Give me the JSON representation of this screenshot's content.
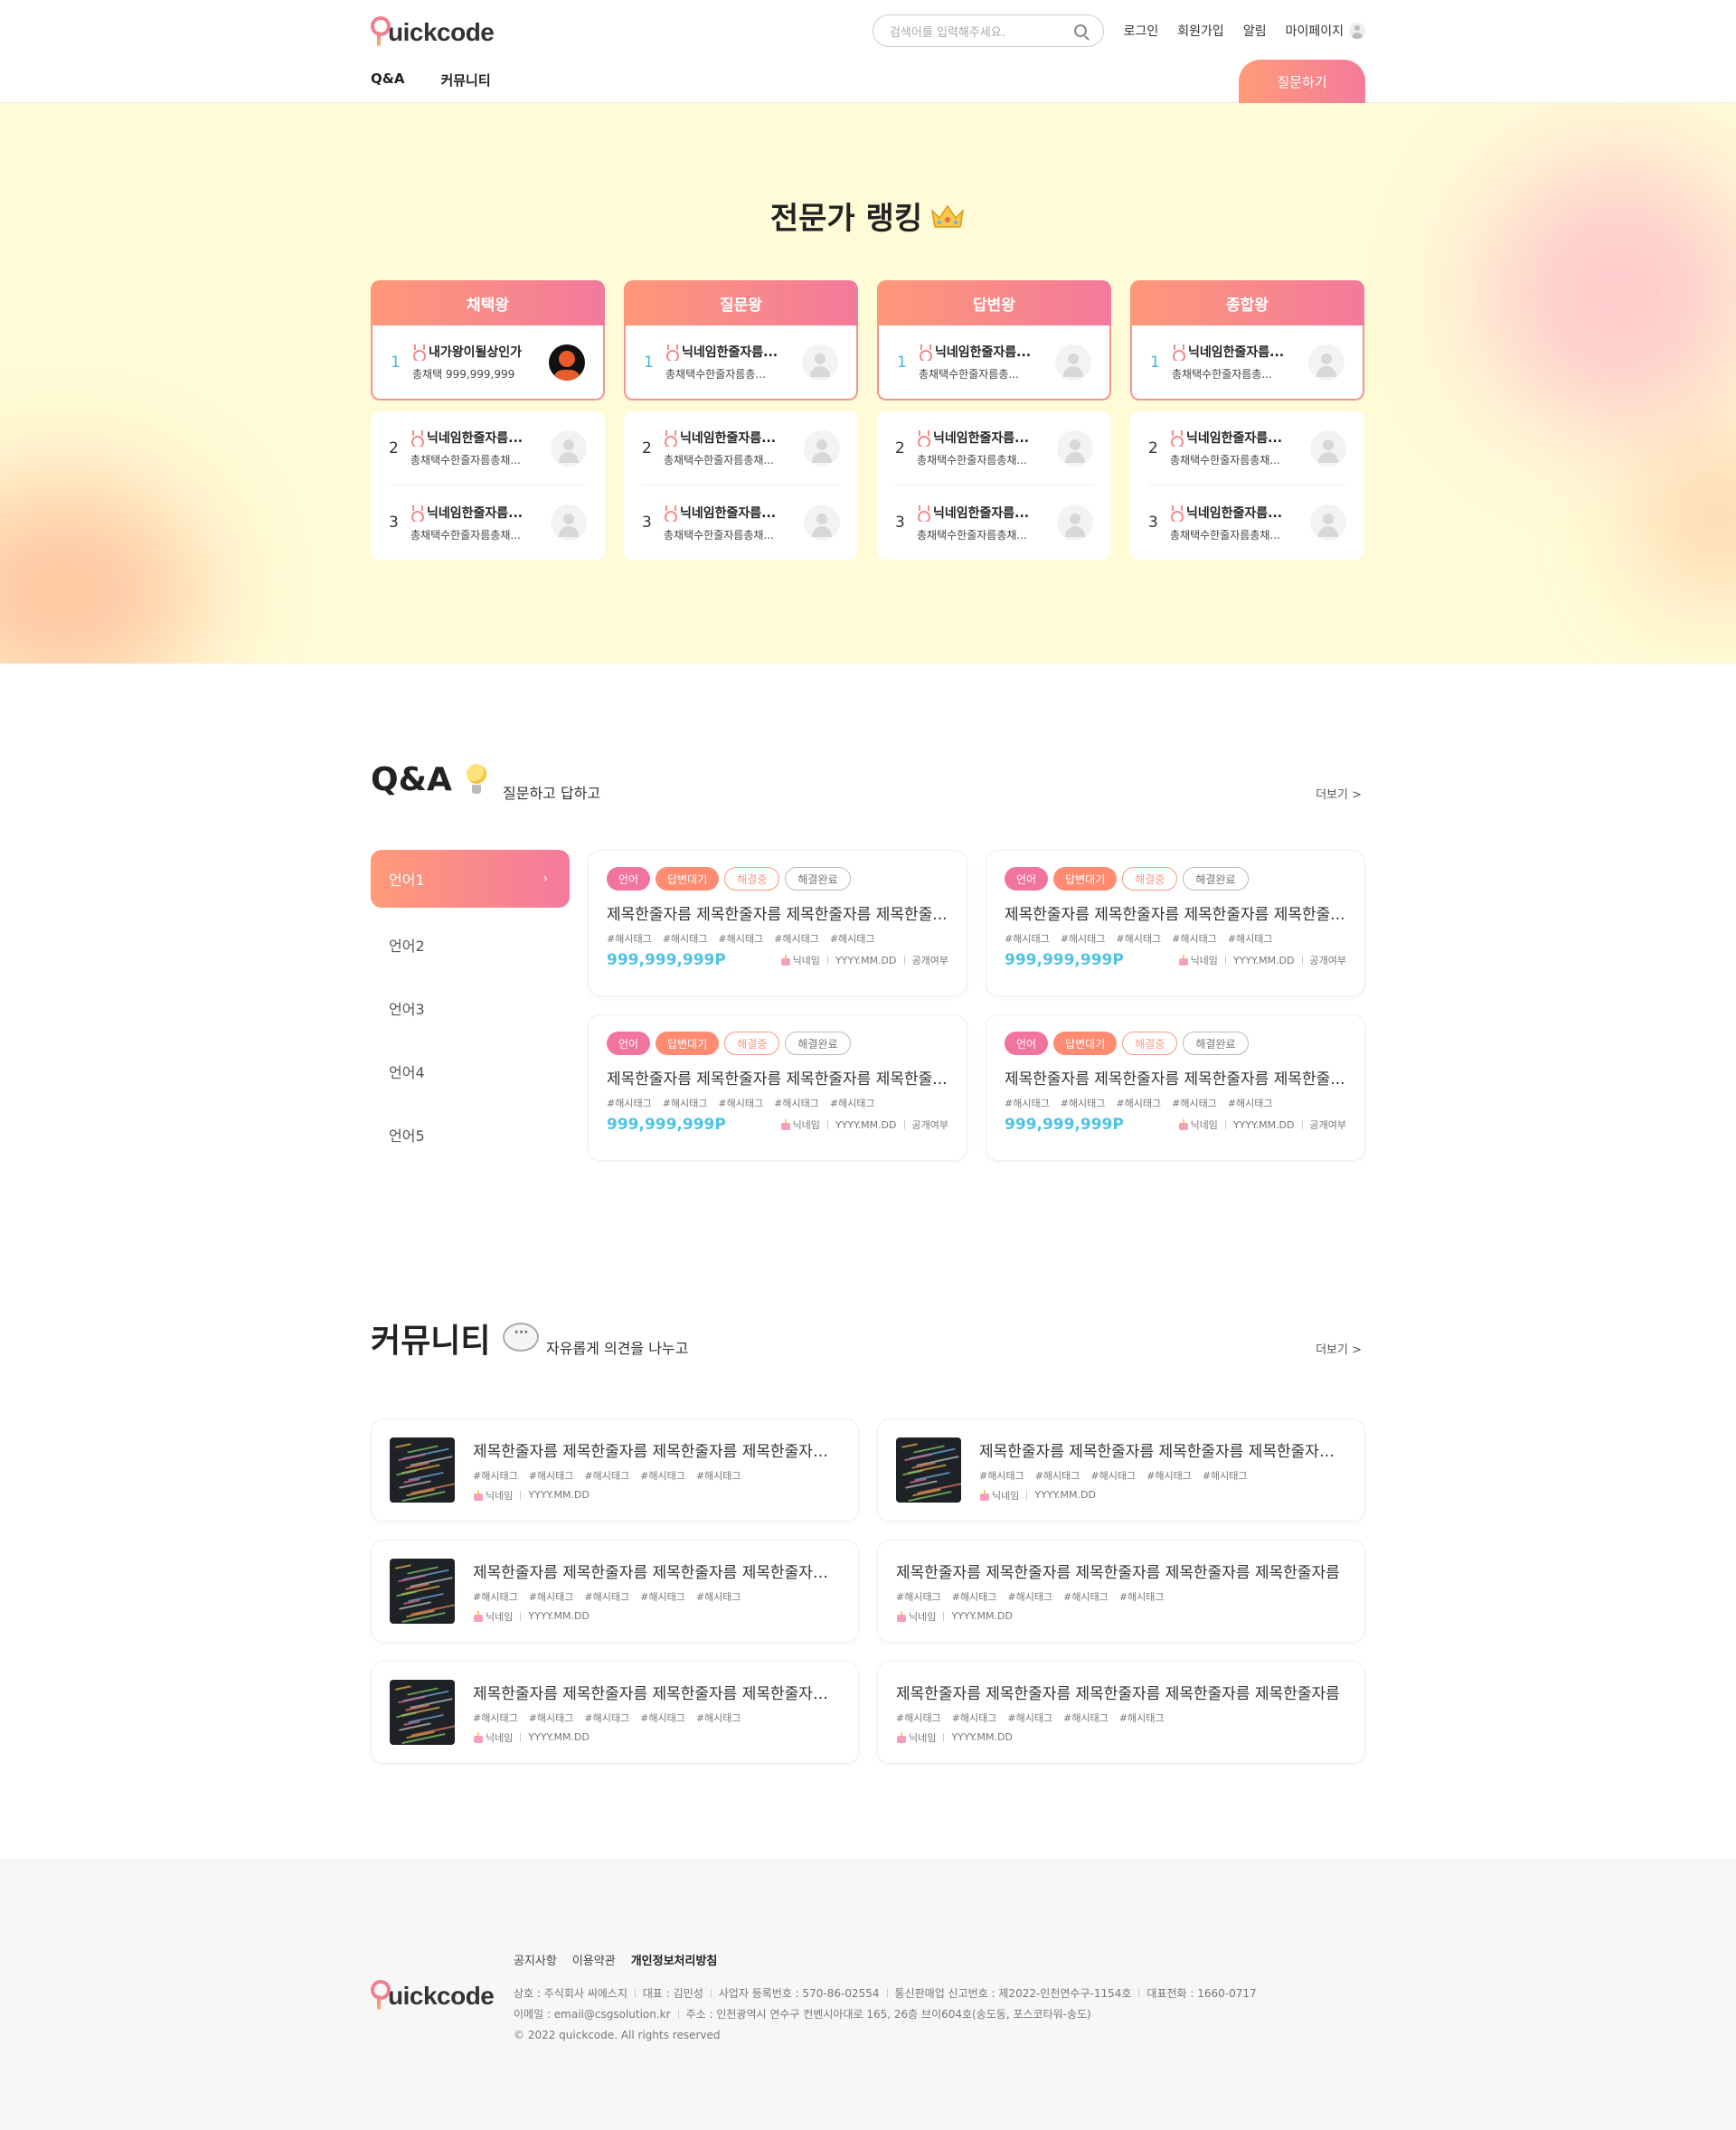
{
  "header": {
    "logo_text": "uickcode",
    "search_placeholder": "검색어를 입력해주세요.",
    "util": [
      "로그인",
      "회원가입",
      "알림",
      "마이페이지"
    ],
    "nav": [
      "Q&A",
      "커뮤니티"
    ],
    "ask_button": "질문하기"
  },
  "ranking": {
    "title": "전문가 랭킹",
    "columns": [
      {
        "title": "채택왕",
        "first": {
          "rank": "1",
          "name": "내가왕이될상인가",
          "sub": "총채택 999,999,999"
        },
        "rest": [
          {
            "rank": "2",
            "name": "닉네임한줄자름...",
            "sub": "총채택수한줄자름총채..."
          },
          {
            "rank": "3",
            "name": "닉네임한줄자름...",
            "sub": "총채택수한줄자름총채..."
          }
        ]
      },
      {
        "title": "질문왕",
        "first": {
          "rank": "1",
          "name": "닉네임한줄자름...",
          "sub": "총채택수한줄자름총..."
        },
        "rest": [
          {
            "rank": "2",
            "name": "닉네임한줄자름...",
            "sub": "총채택수한줄자름총채..."
          },
          {
            "rank": "3",
            "name": "닉네임한줄자름...",
            "sub": "총채택수한줄자름총채..."
          }
        ]
      },
      {
        "title": "답변왕",
        "first": {
          "rank": "1",
          "name": "닉네임한줄자름...",
          "sub": "총채택수한줄자름총..."
        },
        "rest": [
          {
            "rank": "2",
            "name": "닉네임한줄자름...",
            "sub": "총채택수한줄자름총채..."
          },
          {
            "rank": "3",
            "name": "닉네임한줄자름...",
            "sub": "총채택수한줄자름총채..."
          }
        ]
      },
      {
        "title": "종합왕",
        "first": {
          "rank": "1",
          "name": "닉네임한줄자름...",
          "sub": "총채택수한줄자름총..."
        },
        "rest": [
          {
            "rank": "2",
            "name": "닉네임한줄자름...",
            "sub": "총채택수한줄자름총채..."
          },
          {
            "rank": "3",
            "name": "닉네임한줄자름...",
            "sub": "총채택수한줄자름총채..."
          }
        ]
      }
    ]
  },
  "qna": {
    "title": "Q&A",
    "subtitle": "질문하고 답하고",
    "more": "더보기 >",
    "categories": [
      "언어1",
      "언어2",
      "언어3",
      "언어4",
      "언어5"
    ],
    "tags": [
      "언어",
      "답변대기",
      "해결중",
      "해결완료"
    ],
    "cards": [
      {
        "title": "제목한줄자름 제목한줄자름 제목한줄자름 제목한줄...",
        "points": "999,999,999P"
      },
      {
        "title": "제목한줄자름 제목한줄자름 제목한줄자름 제목한줄...",
        "points": "999,999,999P"
      },
      {
        "title": "제목한줄자름 제목한줄자름 제목한줄자름 제목한줄...",
        "points": "999,999,999P"
      },
      {
        "title": "제목한줄자름 제목한줄자름 제목한줄자름 제목한줄...",
        "points": "999,999,999P"
      }
    ],
    "hashtag": "#해시태그",
    "nickname": "닉네임",
    "date": "YYYY.MM.DD",
    "visibility": "공개여부"
  },
  "community": {
    "title": "커뮤니티",
    "subtitle": "자유롭게 의견을 나누고",
    "more": "더보기 >",
    "cards": [
      {
        "title": "제목한줄자름 제목한줄자름 제목한줄자름 제목한줄자름...",
        "thumb": true
      },
      {
        "title": "제목한줄자름 제목한줄자름 제목한줄자름 제목한줄자름...",
        "thumb": true
      },
      {
        "title": "제목한줄자름 제목한줄자름 제목한줄자름 제목한줄자름...",
        "thumb": true
      },
      {
        "title": "제목한줄자름 제목한줄자름 제목한줄자름 제목한줄자름 제목한줄자름",
        "thumb": false
      },
      {
        "title": "제목한줄자름 제목한줄자름 제목한줄자름 제목한줄자름...",
        "thumb": true
      },
      {
        "title": "제목한줄자름 제목한줄자름 제목한줄자름 제목한줄자름 제목한줄자름",
        "thumb": false
      }
    ],
    "hashtag": "#해시태그",
    "nickname": "닉네임",
    "date": "YYYY.MM.DD"
  },
  "footer": {
    "links": [
      "공지사항",
      "이용약관",
      "개인정보처리방침"
    ],
    "line1": [
      "상호 : 주식회사 씨에스지",
      "대표 : 김민성",
      "사업자 등록번호 : 570-86-02554",
      "통신판매업 신고번호 : 제2022-인천연수구-1154호",
      "대표전화 : 1660-0717"
    ],
    "line2": [
      "이메일 : email@csgsolution.kr",
      "주소 : 인천광역시 연수구 컨벤시아대로 165, 26층 브이604호(송도동, 포스코타워-송도)"
    ],
    "copyright": "© 2022 quickcode. All rights reserved"
  },
  "colors": {
    "accent_start": "#ff9b78",
    "accent_end": "#f47b9c",
    "points": "#4ec3e6",
    "ranking_bg": "#fffbd6"
  },
  "icons": [
    "search-icon",
    "user-icon",
    "crown-icon",
    "medal-icon",
    "bulb-icon",
    "chat-bubble-icon",
    "cake-icon",
    "chevron-right-icon"
  ]
}
